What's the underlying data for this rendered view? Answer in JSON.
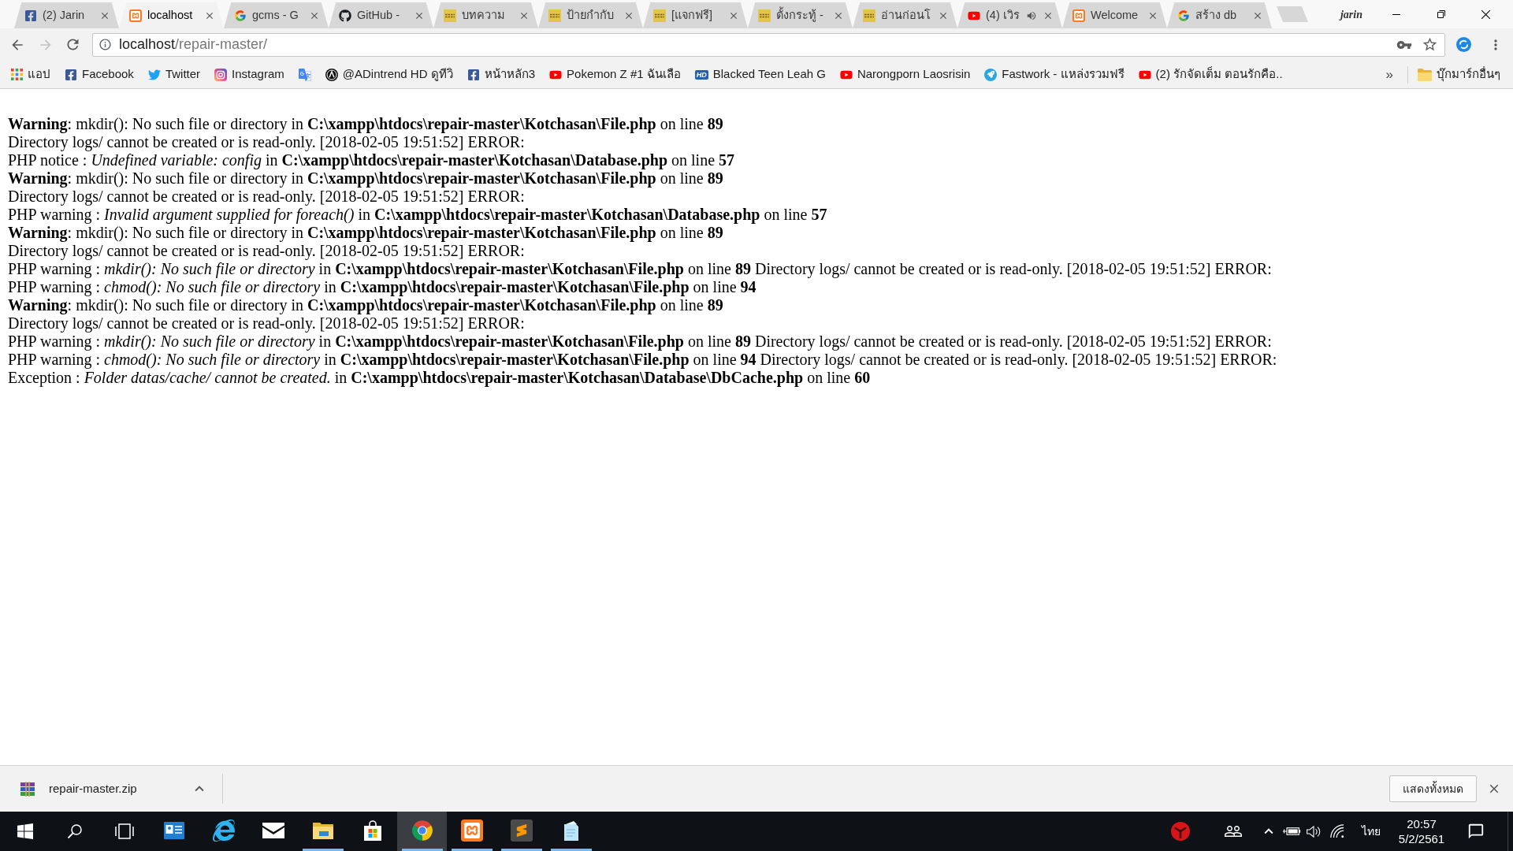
{
  "window": {
    "profile": "jarin"
  },
  "tabs": [
    {
      "title": "(2) Jarin",
      "kind": "facebook",
      "selected": false,
      "audio": false
    },
    {
      "title": "localhost",
      "kind": "xampp",
      "selected": true,
      "audio": false
    },
    {
      "title": "gcms - G",
      "kind": "google",
      "selected": false,
      "audio": false
    },
    {
      "title": "GitHub -",
      "kind": "github",
      "selected": false,
      "audio": false
    },
    {
      "title": "บทความ",
      "kind": "wsr",
      "selected": false,
      "audio": false
    },
    {
      "title": "ป้ายกำกับ",
      "kind": "wsr",
      "selected": false,
      "audio": false
    },
    {
      "title": "[แจกฟรี]",
      "kind": "wsr",
      "selected": false,
      "audio": false
    },
    {
      "title": "ตั้งกระทู้ -",
      "kind": "wsr",
      "selected": false,
      "audio": false
    },
    {
      "title": "อ่านก่อนโ",
      "kind": "wsr",
      "selected": false,
      "audio": false
    },
    {
      "title": "(4) เวิร",
      "kind": "youtube",
      "selected": false,
      "audio": true
    },
    {
      "title": "Welcome",
      "kind": "xampp",
      "selected": false,
      "audio": false
    },
    {
      "title": "สร้าง db",
      "kind": "google",
      "selected": false,
      "audio": false
    }
  ],
  "toolbar": {
    "back": {
      "disabled": false
    },
    "forward": {
      "disabled": true
    },
    "address": {
      "host": "localhost",
      "path": "/repair-master/"
    }
  },
  "bookmarks": [
    {
      "kind": "apps",
      "label": "แอป"
    },
    {
      "kind": "facebook",
      "label": "Facebook"
    },
    {
      "kind": "twitter",
      "label": "Twitter"
    },
    {
      "kind": "instagram",
      "label": "Instagram"
    },
    {
      "kind": "translate"
    },
    {
      "kind": "letter",
      "label": "@ADintrend HD ดูทีวิ"
    },
    {
      "kind": "facebook",
      "label": "หน้าหลัก3"
    },
    {
      "kind": "youtube",
      "label": "Pokemon Z #1 ฉันเลือ"
    },
    {
      "kind": "hd",
      "badge": "HD",
      "label": "Blacked Teen Leah G"
    },
    {
      "kind": "youtube",
      "label": "Narongporn Laosrisin"
    },
    {
      "kind": "fastwork",
      "label": "Fastwork - แหล่งรวมฟรี"
    },
    {
      "kind": "youtube",
      "label": "(2) รักจัดเต็ม ตอนรักคือ.."
    }
  ],
  "bookmarks_more": "»",
  "other_bookmarks": "บุ๊กมาร์กอื่นๆ",
  "page": {
    "lines": [
      "**Warning**: mkdir(): No such file or directory in **C:\\xampp\\htdocs\\repair-master\\Kotchasan\\File.php** on line **89**",
      "Directory logs/ cannot be created or is read-only. [2018-02-05 19:51:52] ERROR:",
      "PHP notice : *Undefined variable: config* in **C:\\xampp\\htdocs\\repair-master\\Kotchasan\\Database.php** on line **57**",
      "**Warning**: mkdir(): No such file or directory in **C:\\xampp\\htdocs\\repair-master\\Kotchasan\\File.php** on line **89**",
      "Directory logs/ cannot be created or is read-only. [2018-02-05 19:51:52] ERROR:",
      "PHP warning : *Invalid argument supplied for foreach()* in **C:\\xampp\\htdocs\\repair-master\\Kotchasan\\Database.php** on line **57**",
      "**Warning**: mkdir(): No such file or directory in **C:\\xampp\\htdocs\\repair-master\\Kotchasan\\File.php** on line **89**",
      "Directory logs/ cannot be created or is read-only. [2018-02-05 19:51:52] ERROR:",
      "PHP warning : *mkdir(): No such file or directory* in **C:\\xampp\\htdocs\\repair-master\\Kotchasan\\File.php** on line **89** Directory logs/ cannot be created or is read-only. [2018-02-05 19:51:52] ERROR:",
      "PHP warning : *chmod(): No such file or directory* in **C:\\xampp\\htdocs\\repair-master\\Kotchasan\\File.php** on line **94**",
      "**Warning**: mkdir(): No such file or directory in **C:\\xampp\\htdocs\\repair-master\\Kotchasan\\File.php** on line **89**",
      "Directory logs/ cannot be created or is read-only. [2018-02-05 19:51:52] ERROR:",
      "PHP warning : *mkdir(): No such file or directory* in **C:\\xampp\\htdocs\\repair-master\\Kotchasan\\File.php** on line **89** Directory logs/ cannot be created or is read-only. [2018-02-05 19:51:52] ERROR:",
      "PHP warning : *chmod(): No such file or directory* in **C:\\xampp\\htdocs\\repair-master\\Kotchasan\\File.php** on line **94** Directory logs/ cannot be created or is read-only. [2018-02-05 19:51:52] ERROR:",
      "Exception : *Folder datas/cache/ cannot be created.* in **C:\\xampp\\htdocs\\repair-master\\Kotchasan\\Database\\DbCache.php** on line **60**"
    ]
  },
  "download_bar": {
    "file": "repair-master.zip",
    "show_all": "แสดงทั้งหมด"
  },
  "taskbar": {
    "apps": [
      {
        "kind": "card",
        "running": false,
        "active": false
      },
      {
        "kind": "ie",
        "running": false,
        "active": false
      },
      {
        "kind": "envelope",
        "running": false,
        "active": false
      },
      {
        "kind": "folder",
        "running": true,
        "active": false
      },
      {
        "kind": "bag",
        "running": false,
        "active": false
      },
      {
        "kind": "chrome",
        "running": true,
        "active": true
      },
      {
        "kind": "xampp",
        "running": true,
        "active": false
      },
      {
        "kind": "sublime",
        "running": true,
        "active": false
      },
      {
        "kind": "notepad",
        "running": true,
        "active": false
      }
    ],
    "tray": {
      "language": "ไทย",
      "time": "20:57",
      "date": "5/2/2561"
    }
  }
}
